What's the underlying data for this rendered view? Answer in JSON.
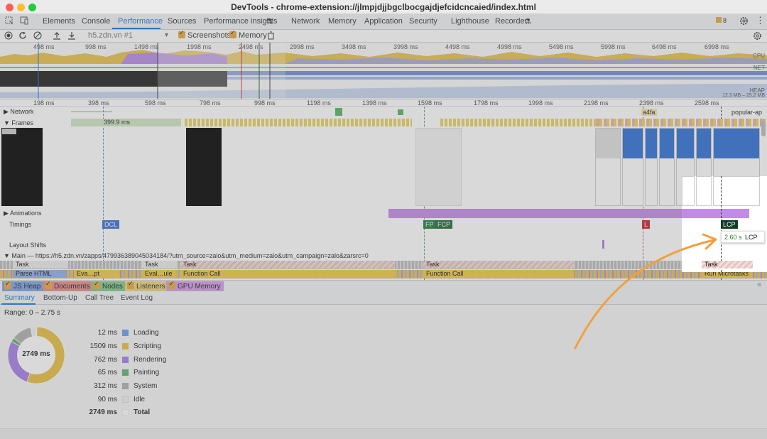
{
  "window": {
    "title": "DevTools - chrome-extension://jlmpjdjjbgclbocgajdjefcidcncaied/index.html",
    "controls": [
      "close",
      "minimize",
      "zoom"
    ]
  },
  "tabs": [
    {
      "label": "Elements"
    },
    {
      "label": "Console"
    },
    {
      "label": "Performance",
      "active": true
    },
    {
      "label": "Sources"
    },
    {
      "label": "Performance insights"
    },
    {
      "label": "Network"
    },
    {
      "label": "Memory"
    },
    {
      "label": "Application"
    },
    {
      "label": "Security"
    },
    {
      "label": "Lighthouse"
    },
    {
      "label": "Recorder"
    }
  ],
  "issues_badge": "8",
  "toolbar": {
    "recording_select": "h5.zdn.vn #1",
    "screenshots_label": "Screenshots",
    "memory_label": "Memory",
    "screenshots_checked": true,
    "memory_checked": true
  },
  "overview": {
    "ticks": [
      "498 ms",
      "998 ms",
      "1498 ms",
      "1998 ms",
      "2498 ms",
      "2998 ms",
      "3498 ms",
      "3998 ms",
      "4498 ms",
      "4998 ms",
      "5498 ms",
      "5998 ms",
      "6498 ms",
      "6998 ms"
    ],
    "cpu_label": "CPU",
    "net_label": "NET",
    "heap_label": "HEAP",
    "heap_range": "12.3 MB – 25.2 MB"
  },
  "ruler": [
    "198 ms",
    "398 ms",
    "598 ms",
    "798 ms",
    "998 ms",
    "1198 ms",
    "1398 ms",
    "1598 ms",
    "1798 ms",
    "1998 ms",
    "2198 ms",
    "2398 ms",
    "2598 ms"
  ],
  "tracks": {
    "network": "Network",
    "network_items": [
      "a4fa",
      "popular-ap"
    ],
    "frames": "Frames",
    "frame_time": "399.9 ms",
    "animations": "Animations",
    "timings": "Timings",
    "layout_shifts": "Layout Shifts",
    "main": "Main — https://h5.zdn.vn/zapps/479936389045034184/?utm_source=zalo&utm_medium=zalo&utm_campaign=zalo&zarsrc=0"
  },
  "markers": {
    "dcl": "DCL",
    "fp": "FP",
    "fcp": "FCP",
    "l": "L",
    "lcp": "LCP"
  },
  "lcp_tooltip": {
    "time": "2.60 s",
    "label": "LCP"
  },
  "flame": {
    "row1": [
      "Task",
      "Task",
      "Task",
      "Task",
      "Task"
    ],
    "row2": [
      "Parse HTML",
      "Eva…pt",
      "Eval…ule",
      "Function Call",
      "Function Call",
      "Run Microtasks"
    ]
  },
  "legend": [
    {
      "label": "JS Heap",
      "color": "#5c8fe0"
    },
    {
      "label": "Documents",
      "color": "#e06a6a"
    },
    {
      "label": "Nodes",
      "color": "#53b461"
    },
    {
      "label": "Listeners",
      "color": "#e8c25a"
    },
    {
      "label": "GPU Memory",
      "color": "#c276e0"
    }
  ],
  "bottom_tabs": [
    {
      "label": "Summary",
      "active": true
    },
    {
      "label": "Bottom-Up"
    },
    {
      "label": "Call Tree"
    },
    {
      "label": "Event Log"
    }
  ],
  "summary": {
    "range": "Range: 0 – 2.75 s",
    "donut_total": "2749 ms",
    "rows": [
      {
        "value": "12 ms",
        "label": "Loading",
        "color": "#6e9be6"
      },
      {
        "value": "1509 ms",
        "label": "Scripting",
        "color": "#e8bf40"
      },
      {
        "value": "762 ms",
        "label": "Rendering",
        "color": "#a77ee6"
      },
      {
        "value": "65 ms",
        "label": "Painting",
        "color": "#5fb370"
      },
      {
        "value": "312 ms",
        "label": "System",
        "color": "#b0b0b0"
      },
      {
        "value": "90 ms",
        "label": "Idle",
        "color": "#f0f0f0"
      },
      {
        "value": "2749 ms",
        "label": "Total",
        "color": "#ffffff"
      }
    ]
  },
  "colors": {
    "accent": "#1a73e8",
    "arrow": "#f0a040",
    "lcp_green": "#2e7d32"
  }
}
